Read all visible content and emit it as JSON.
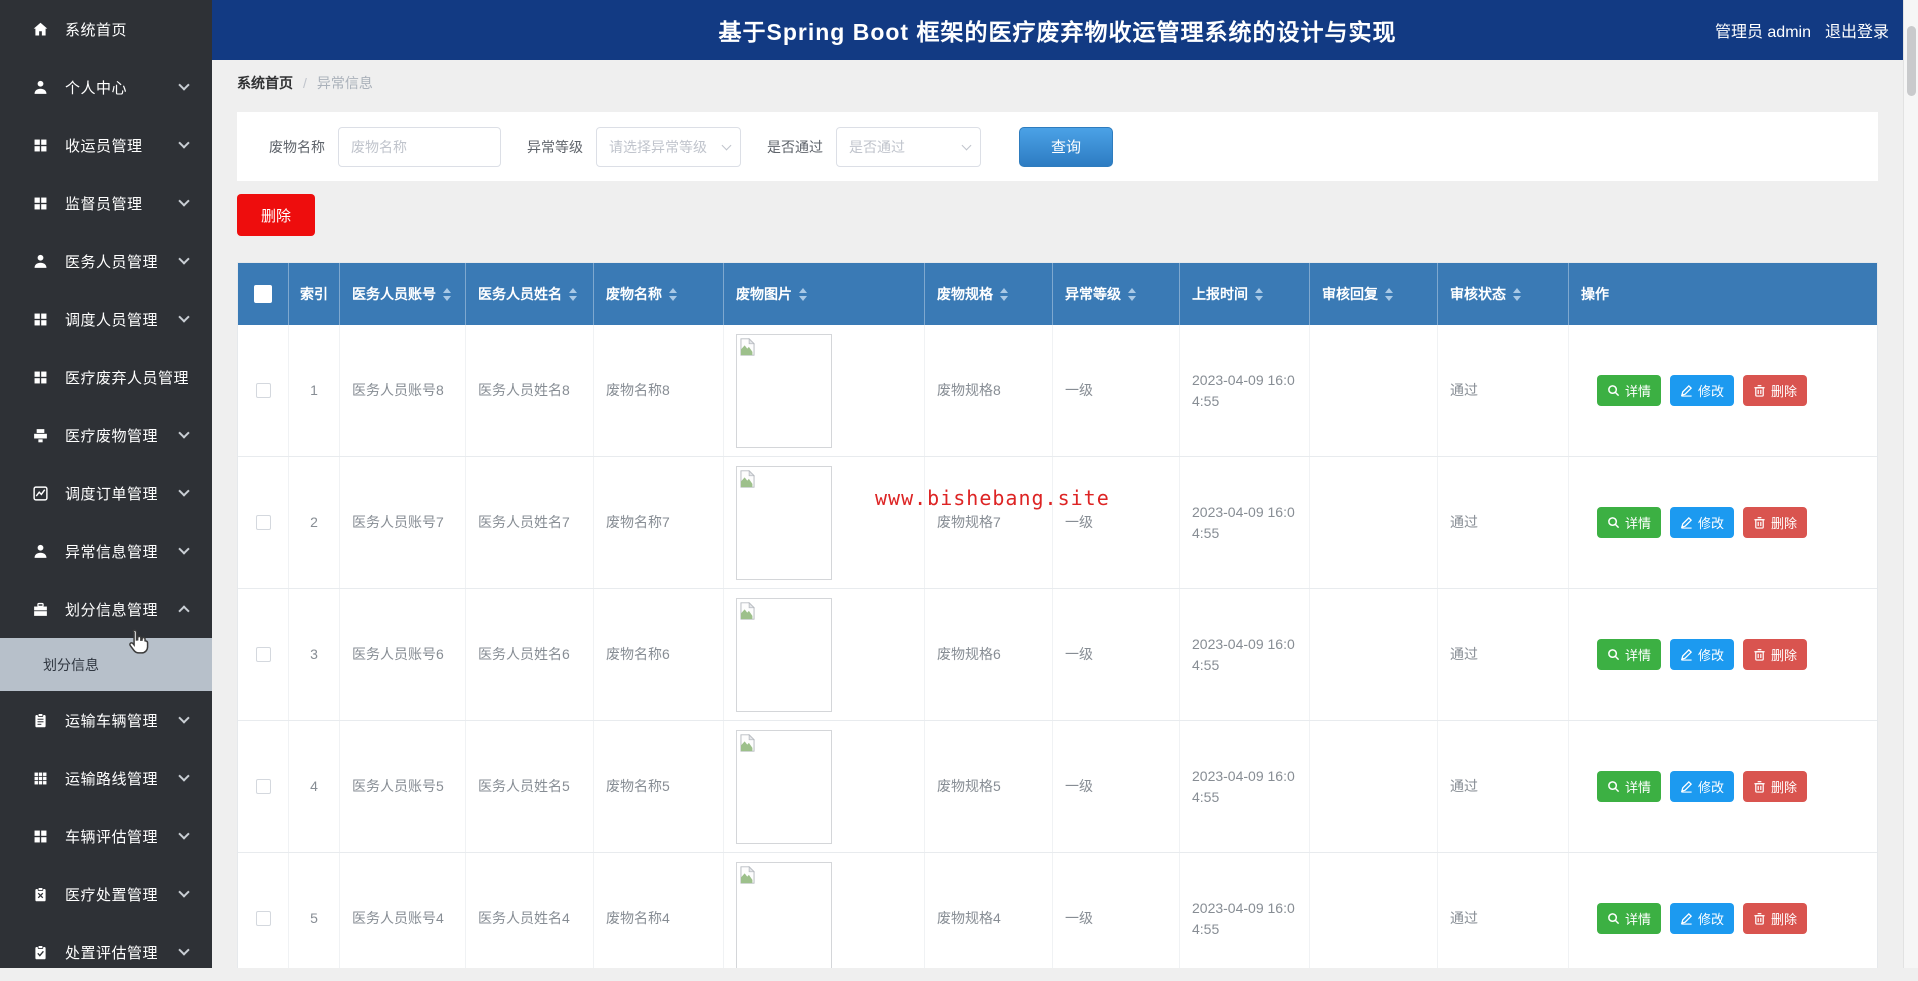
{
  "header": {
    "title": "基于Spring Boot 框架的医疗废弃物收运管理系统的设计与实现",
    "user_label": "管理员 admin",
    "logout_label": "退出登录"
  },
  "sidebar": {
    "items": [
      {
        "label": "系统首页",
        "icon": "home-icon",
        "chevron": false
      },
      {
        "label": "个人中心",
        "icon": "user-icon",
        "chevron": true
      },
      {
        "label": "收运员管理",
        "icon": "grid-icon",
        "chevron": true
      },
      {
        "label": "监督员管理",
        "icon": "grid-icon",
        "chevron": true
      },
      {
        "label": "医务人员管理",
        "icon": "user-icon",
        "chevron": true
      },
      {
        "label": "调度人员管理",
        "icon": "grid-icon",
        "chevron": true
      },
      {
        "label": "医疗废弃人员管理",
        "icon": "grid-icon",
        "chevron": false
      },
      {
        "label": "医疗废物管理",
        "icon": "printer-icon",
        "chevron": true
      },
      {
        "label": "调度订单管理",
        "icon": "chart-icon",
        "chevron": true
      },
      {
        "label": "异常信息管理",
        "icon": "user-icon",
        "chevron": true
      },
      {
        "label": "划分信息管理",
        "icon": "briefcase-icon",
        "chevron": true,
        "expanded": true,
        "submenu": [
          {
            "label": "划分信息",
            "active": true
          }
        ]
      },
      {
        "label": "运输车辆管理",
        "icon": "clipboard-icon",
        "chevron": true
      },
      {
        "label": "运输路线管理",
        "icon": "grid9-icon",
        "chevron": true
      },
      {
        "label": "车辆评估管理",
        "icon": "grid-icon",
        "chevron": true
      },
      {
        "label": "医疗处置管理",
        "icon": "clipboard-x-icon",
        "chevron": true
      },
      {
        "label": "处置评估管理",
        "icon": "clipboard-check-icon",
        "chevron": true
      }
    ]
  },
  "breadcrumb": {
    "root": "系统首页",
    "separator": "/",
    "current": "异常信息"
  },
  "filters": {
    "name_label": "废物名称",
    "name_placeholder": "废物名称",
    "name_value": "",
    "level_label": "异常等级",
    "level_placeholder": "请选择异常等级",
    "pass_label": "是否通过",
    "pass_placeholder": "是否通过",
    "search_label": "查询"
  },
  "toolbar": {
    "delete_label": "删除"
  },
  "watermark": {
    "text": "www.bishebang.site"
  },
  "table": {
    "columns": [
      {
        "label": "",
        "type": "checkbox",
        "sortable": false
      },
      {
        "label": "索引",
        "sortable": false
      },
      {
        "label": "医务人员账号",
        "sortable": true
      },
      {
        "label": "医务人员姓名",
        "sortable": true
      },
      {
        "label": "废物名称",
        "sortable": true
      },
      {
        "label": "废物图片",
        "sortable": true
      },
      {
        "label": "废物规格",
        "sortable": true
      },
      {
        "label": "异常等级",
        "sortable": true
      },
      {
        "label": "上报时间",
        "sortable": true
      },
      {
        "label": "审核回复",
        "sortable": true
      },
      {
        "label": "审核状态",
        "sortable": true
      },
      {
        "label": "操作",
        "sortable": false
      }
    ],
    "rows": [
      {
        "index": "1",
        "account": "医务人员账号8",
        "name": "医务人员姓名8",
        "waste": "废物名称8",
        "spec": "废物规格8",
        "level": "一级",
        "time": "2023-04-09 16:04:55",
        "reply": "",
        "status": "通过"
      },
      {
        "index": "2",
        "account": "医务人员账号7",
        "name": "医务人员姓名7",
        "waste": "废物名称7",
        "spec": "废物规格7",
        "level": "一级",
        "time": "2023-04-09 16:04:55",
        "reply": "",
        "status": "通过"
      },
      {
        "index": "3",
        "account": "医务人员账号6",
        "name": "医务人员姓名6",
        "waste": "废物名称6",
        "spec": "废物规格6",
        "level": "一级",
        "time": "2023-04-09 16:04:55",
        "reply": "",
        "status": "通过"
      },
      {
        "index": "4",
        "account": "医务人员账号5",
        "name": "医务人员姓名5",
        "waste": "废物名称5",
        "spec": "废物规格5",
        "level": "一级",
        "time": "2023-04-09 16:04:55",
        "reply": "",
        "status": "通过"
      },
      {
        "index": "5",
        "account": "医务人员账号4",
        "name": "医务人员姓名4",
        "waste": "废物名称4",
        "spec": "废物规格4",
        "level": "一级",
        "time": "2023-04-09 16:04:55",
        "reply": "",
        "status": "通过"
      }
    ],
    "actions": {
      "detail": "详情",
      "edit": "修改",
      "delete": "删除"
    }
  },
  "colors": {
    "header_bg": "#123a83",
    "sidebar_bg": "#2e3136",
    "table_header_bg": "#3a7ab5",
    "delete_red": "#ee0d0d",
    "detail_green": "#3cb043",
    "edit_blue": "#1c9af0",
    "small_delete_red": "#d9544f",
    "watermark_red": "#dd2424"
  }
}
